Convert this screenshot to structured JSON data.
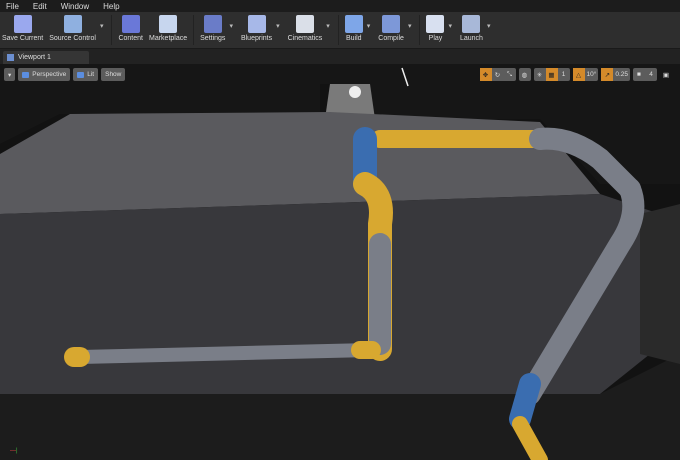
{
  "menu": [
    "File",
    "Edit",
    "Window",
    "Help"
  ],
  "toolbar": [
    {
      "label": "Save Current",
      "icon": "save-icon",
      "color": "#9aa8ee",
      "dropdown": false
    },
    {
      "label": "Source Control",
      "icon": "source-control-icon",
      "color": "#8fb0e0",
      "dropdown": true
    },
    {
      "label": "Content",
      "icon": "content-icon",
      "color": "#6a78d8",
      "dropdown": false
    },
    {
      "label": "Marketplace",
      "icon": "marketplace-icon",
      "color": "#c7d6ee",
      "dropdown": false
    },
    {
      "label": "Settings",
      "icon": "settings-icon",
      "color": "#6a7cc8",
      "dropdown": true
    },
    {
      "label": "Blueprints",
      "icon": "blueprints-icon",
      "color": "#a7b8e8",
      "dropdown": true
    },
    {
      "label": "Cinematics",
      "icon": "cinematics-icon",
      "color": "#dadfe8",
      "dropdown": true
    },
    {
      "label": "Build",
      "icon": "build-icon",
      "color": "#7ea6e8",
      "dropdown": true
    },
    {
      "label": "Compile",
      "icon": "compile-icon",
      "color": "#7d98d8",
      "dropdown": true
    },
    {
      "label": "Play",
      "icon": "play-icon",
      "color": "#d8e0f0",
      "dropdown": true
    },
    {
      "label": "Launch",
      "icon": "launch-icon",
      "color": "#a8b8d8",
      "dropdown": true
    }
  ],
  "tab": {
    "label": "Viewport 1"
  },
  "viewport": {
    "perspective": "Perspective",
    "lit": "Lit",
    "show": "Show",
    "angle_snap": "10°",
    "scale_snap": "0.25",
    "camera_speed": "4",
    "grid_snap": "1"
  },
  "colors": {
    "accent": "#d48a2a",
    "pipe_yellow": "#d8a830",
    "pipe_blue": "#3a6db0",
    "pipe_gray": "#7a7e88"
  }
}
